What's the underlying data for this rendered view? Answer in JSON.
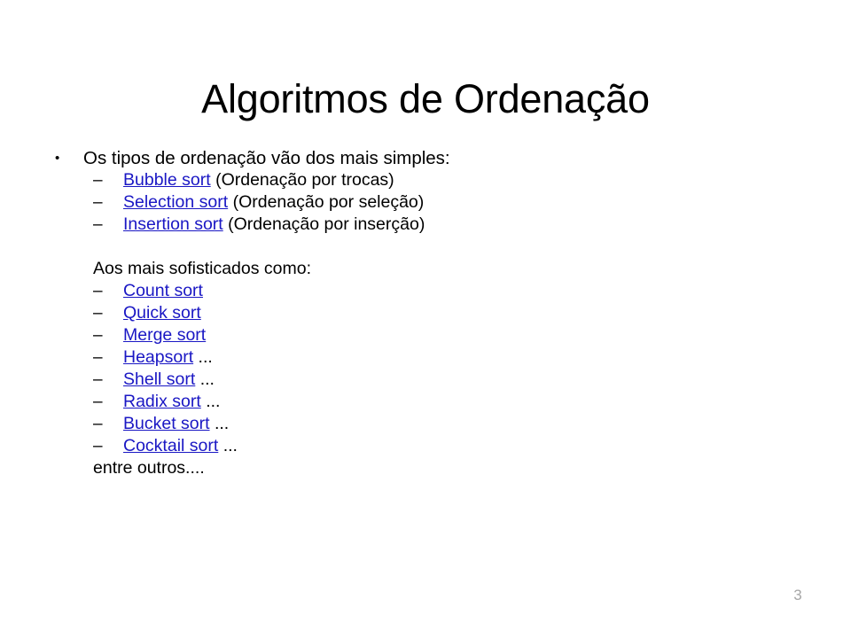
{
  "slide": {
    "title": "Algoritmos de Ordenação",
    "page_number": "3",
    "link_color": "#1a17c4",
    "text_color": "#000000",
    "background_color": "#ffffff",
    "bullet_glyph": "•",
    "dash_glyph": "–",
    "intro": {
      "text": "Os tipos de ordenação vão dos mais simples:"
    },
    "simple_sorts": [
      {
        "link": "Bubble sort",
        "tail": " (Ordenação por trocas)"
      },
      {
        "link": "Selection sort",
        "tail": "  (Ordenação por seleção)"
      },
      {
        "link": "Insertion sort",
        "tail": "  (Ordenação por inserção)"
      }
    ],
    "advanced_heading": "Aos mais sofisticados como:",
    "advanced_sorts": [
      {
        "link": "Count sort",
        "tail": ""
      },
      {
        "link": "Quick sort",
        "tail": ""
      },
      {
        "link": "Merge sort",
        "tail": ""
      },
      {
        "link": "Heapsort",
        "tail": " ..."
      },
      {
        "link": "Shell sort",
        "tail": " ..."
      },
      {
        "link": "Radix sort",
        "tail": " ..."
      },
      {
        "link": "Bucket sort",
        "tail": " ..."
      },
      {
        "link": "Cocktail sort",
        "tail": " ..."
      }
    ],
    "closing": "entre outros...."
  }
}
